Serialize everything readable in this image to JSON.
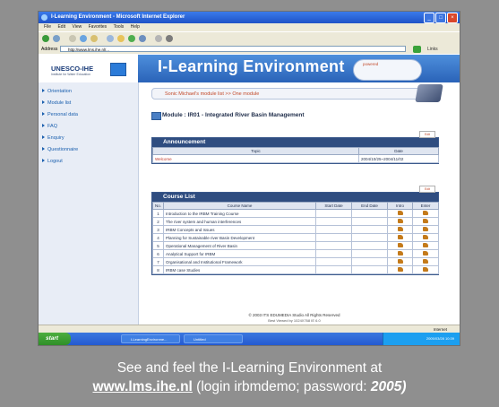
{
  "browser": {
    "window_title": "I-Learning Environment - Microsoft Internet Explorer",
    "menu": [
      "File",
      "Edit",
      "View",
      "Favorites",
      "Tools",
      "Help"
    ],
    "address_label": "Address",
    "address_value": "http://www.lms.ihe.nl/...",
    "links_label": "Links"
  },
  "site": {
    "logo_text": "UNESCO-IHE",
    "logo_subtext": "Institute for Water Education",
    "title": "I-Learning Environment",
    "badge_text": "powered"
  },
  "sidebar": {
    "items": [
      {
        "label": "Orientation"
      },
      {
        "label": "Module list"
      },
      {
        "label": "Personal data"
      },
      {
        "label": "FAQ"
      },
      {
        "label": "Enquiry"
      },
      {
        "label": "Questionnaire"
      },
      {
        "label": "Logout"
      }
    ]
  },
  "breadcrumb": "Sonic Michael's module list >> One module",
  "module_title": "Module : IR01 - Integrated River Basin Management",
  "announcement": {
    "heading": "Announcement",
    "tool_label": "Edit",
    "columns": [
      "Topic",
      "Date"
    ],
    "rows": [
      {
        "topic": "Welcome",
        "date": "2004/10/25~2004/11/02"
      }
    ]
  },
  "course_list": {
    "heading": "Course List",
    "tool_label": "Edit",
    "columns": [
      "No.",
      "Course Name",
      "Start Date",
      "End Date",
      "Intro",
      "Enter"
    ],
    "rows": [
      {
        "no": "1",
        "name": "Introduction to the IRBM Training Course"
      },
      {
        "no": "2",
        "name": "The river system and human interferences"
      },
      {
        "no": "3",
        "name": "IRBM Concepts and Issues"
      },
      {
        "no": "4",
        "name": "Planning for Sustainable river Basin Development"
      },
      {
        "no": "5",
        "name": "Operational Management of River Basin"
      },
      {
        "no": "6",
        "name": "Analytical Support for IRBM"
      },
      {
        "no": "7",
        "name": "Organisational and Institutional Framework"
      },
      {
        "no": "8",
        "name": "IRBM case Studies"
      }
    ]
  },
  "footer": {
    "copyright": "© 2003 ITS EDUMEDIA Studio All Rights Reserved",
    "best_viewed": "Best Viewed by 1024X768 IE 6.0"
  },
  "status": {
    "zone": "Internet"
  },
  "taskbar": {
    "start_label": "start",
    "tasks": [
      "I-LearningEnvironme...",
      "Untitled"
    ],
    "tray_text": "2005/03/28 10:39"
  },
  "caption": {
    "line1": "See and feel the I-Learning Environment at",
    "url": "www.lms.ihe.nl",
    "login_text": " (login irbmdemo; password: ",
    "password": "2005)"
  }
}
